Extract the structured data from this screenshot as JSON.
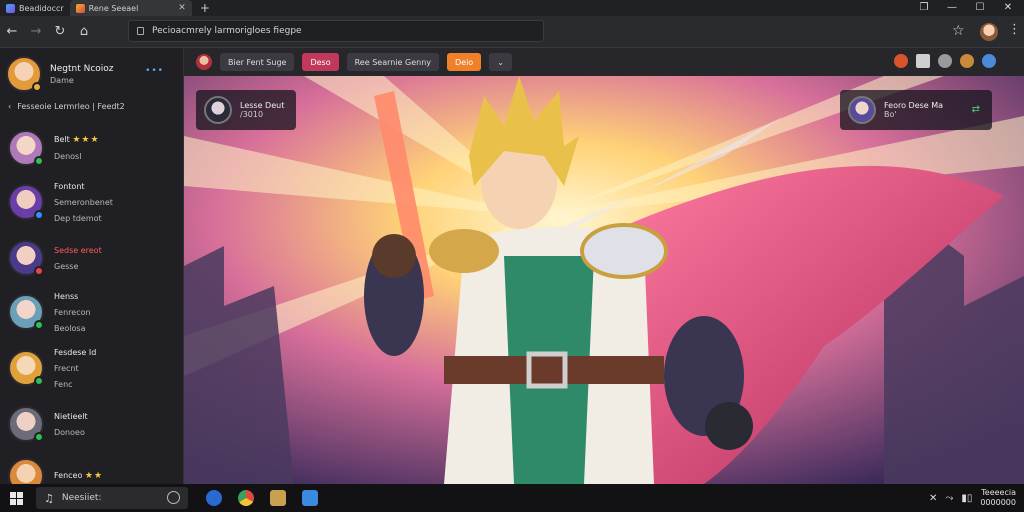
{
  "tabs": [
    {
      "label": "Beadidoccr",
      "active": false
    },
    {
      "label": "Rene Seeael",
      "active": true
    }
  ],
  "address_bar": {
    "value": "Pecioacmrely larmorigloes fiegpe"
  },
  "sidebar": {
    "user": {
      "name": "Negtnt Ncoioz",
      "status": "Dame"
    },
    "section_label": "Fesseoie Lermrleo | Feedt2",
    "friends": [
      {
        "line1": "Belt",
        "line2": "Denosl",
        "stars": "★★★",
        "status": "green"
      },
      {
        "line1": "Fontont",
        "line2": "Semeronbenet",
        "line3": "Dep tdemot",
        "status": "blue"
      },
      {
        "line1": "Sedse ereot",
        "line2": "Gesse",
        "status": "red"
      },
      {
        "line1": "Henss",
        "line2": "Fenrecon",
        "line3": "Beolosa",
        "status": "green"
      },
      {
        "line1": "Fesdese Id",
        "line2": "Frecnt",
        "line3": "Fenc",
        "status": "yellow"
      },
      {
        "line1": "Nietieelt",
        "line2": "Donoeo",
        "status": "green"
      },
      {
        "line1": "Fenceo",
        "stars": "★★",
        "status": "green"
      }
    ]
  },
  "content_toolbar": {
    "chips": [
      "Bier Fent Suge",
      "Deso",
      "Ree Searnie Genny",
      "Deio"
    ],
    "dropdown": "⌄"
  },
  "overlays": {
    "left": {
      "name": "Lesse Deut",
      "value": "/3010"
    },
    "right": {
      "name": "Feoro Dese Ma",
      "sub": "Bo'"
    }
  },
  "taskbar": {
    "search_text": "Neesiiet:",
    "time": "Teeeecia",
    "date": "0000000"
  },
  "colors": {
    "accent_pink": "#c0395a",
    "accent_orange": "#f0802a",
    "online": "#2fbf55"
  }
}
